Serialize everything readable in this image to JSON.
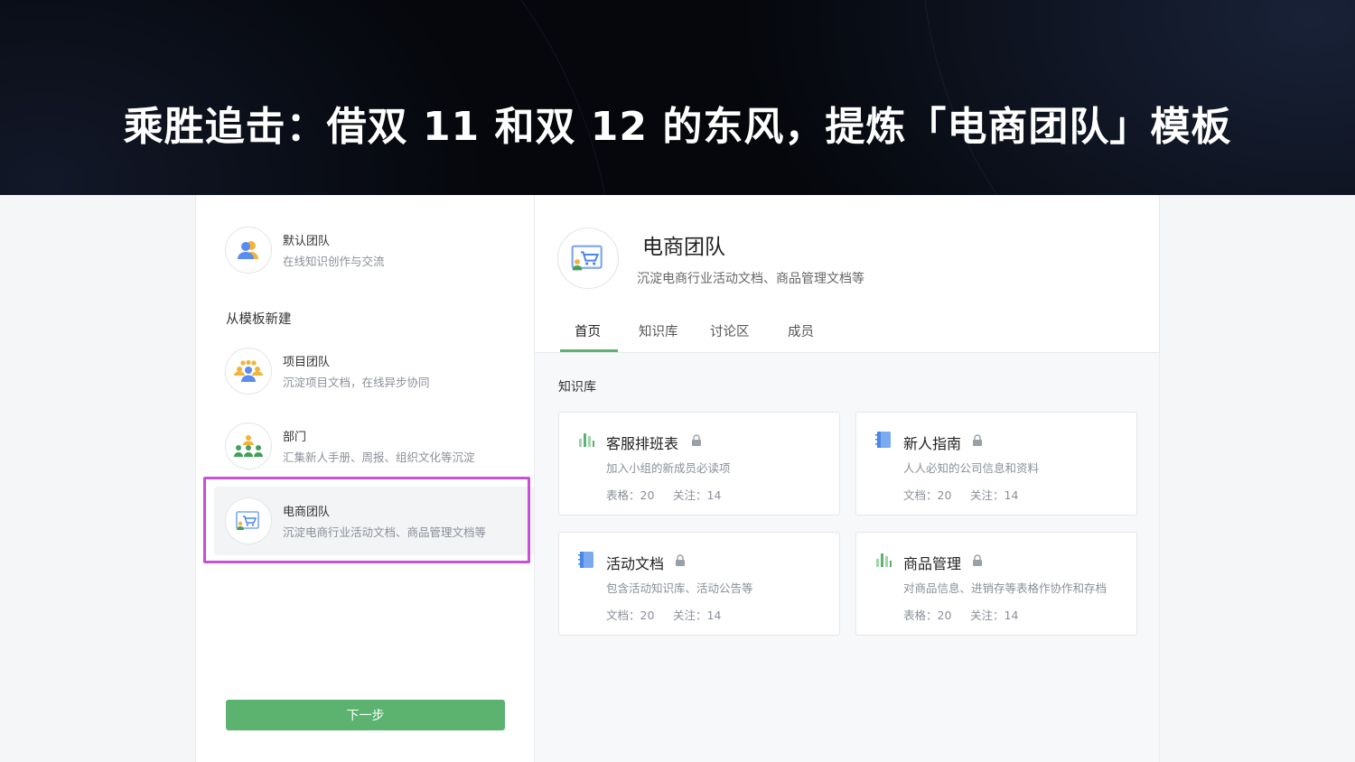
{
  "banner": {
    "title": "乘胜追击：借双 11 和双 12 的东风，提炼「电商团队」模板"
  },
  "sidebar": {
    "default_team": {
      "name": "默认团队",
      "desc": "在线知识创作与交流",
      "icon": "people-icon"
    },
    "section_label": "从模板新建",
    "templates": [
      {
        "name": "项目团队",
        "desc": "沉淀项目文档，在线异步协同",
        "icon": "group-icon"
      },
      {
        "name": "部门",
        "desc": "汇集新人手册、周报、组织文化等沉淀",
        "icon": "department-icon"
      },
      {
        "name": "电商团队",
        "desc": "沉淀电商行业活动文档、商品管理文档等",
        "icon": "shop-icon",
        "selected": true
      }
    ],
    "next_button": "下一步"
  },
  "main": {
    "team_name": "电商团队",
    "team_desc": "沉淀电商行业活动文档、商品管理文档等",
    "tabs": [
      "首页",
      "知识库",
      "讨论区",
      "成员"
    ],
    "active_tab": "首页",
    "section_title": "知识库",
    "cards": [
      {
        "title": "客服排班表",
        "desc": "加入小组的新成员必读项",
        "stat_type": "表格：20",
        "follow": "关注：14",
        "icon": "bar-chart-icon",
        "locked": true
      },
      {
        "title": "新人指南",
        "desc": "人人必知的公司信息和资料",
        "stat_type": "文档：20",
        "follow": "关注：14",
        "icon": "notebook-icon",
        "locked": true
      },
      {
        "title": "活动文档",
        "desc": "包含活动知识库、活动公告等",
        "stat_type": "文档：20",
        "follow": "关注：14",
        "icon": "notebook-icon",
        "locked": true
      },
      {
        "title": "商品管理",
        "desc": "对商品信息、进销存等表格作协作和存档",
        "stat_type": "表格：20",
        "follow": "关注：14",
        "icon": "bar-chart-icon",
        "locked": true
      }
    ]
  },
  "colors": {
    "accent": "#5cb36f",
    "highlight": "#c84fd6",
    "banner_bg": "#05070c"
  }
}
